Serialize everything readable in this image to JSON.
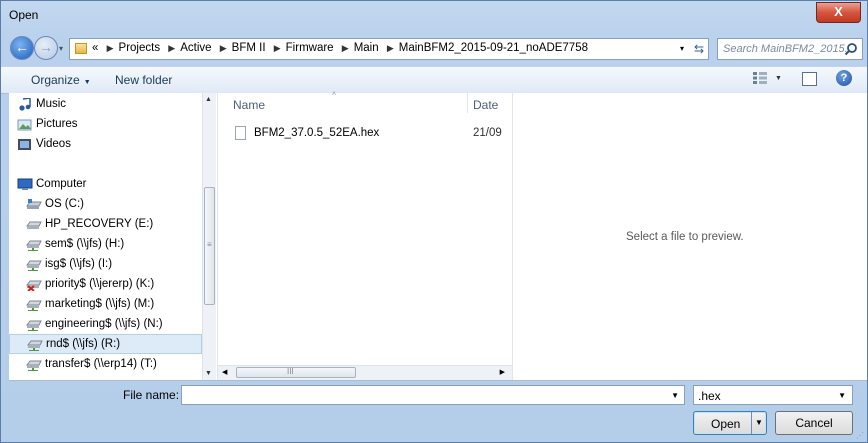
{
  "window": {
    "title": "Open",
    "close_glyph": "X"
  },
  "nav": {
    "back_glyph": "←",
    "forward_glyph": "→",
    "recent_glyph": "▾",
    "crumb_prefix": "«",
    "breadcrumbs": [
      "Projects",
      "Active",
      "BFM II",
      "Firmware",
      "Main",
      "MainBFM2_2015-09-21_noADE7758"
    ],
    "crumb_sep": "▶",
    "address_dropdown_glyph": "▾",
    "refresh_glyph": "⇆",
    "search_placeholder": "Search MainBFM2_2015..."
  },
  "toolbar": {
    "organize_label": "Organize",
    "organize_dd": "▼",
    "new_folder_label": "New folder",
    "views_dd": "▼",
    "help_glyph": "?"
  },
  "navpane": {
    "items": [
      {
        "label": "Music",
        "icon": "music-icon"
      },
      {
        "label": "Pictures",
        "icon": "pictures-icon"
      },
      {
        "label": "Videos",
        "icon": "videos-icon"
      },
      {
        "label": "Computer",
        "icon": "computer-icon"
      },
      {
        "label": "OS (C:)",
        "icon": "drive-icon"
      },
      {
        "label": "HP_RECOVERY (E:)",
        "icon": "drive-icon"
      },
      {
        "label": "sem$ (\\\\jfs) (H:)",
        "icon": "network-drive-icon"
      },
      {
        "label": "isg$ (\\\\jfs) (I:)",
        "icon": "network-drive-icon"
      },
      {
        "label": "priority$ (\\\\jererp) (K:)",
        "icon": "disconnected-drive-icon"
      },
      {
        "label": "marketing$ (\\\\jfs) (M:)",
        "icon": "network-drive-icon"
      },
      {
        "label": "engineering$ (\\\\jfs) (N:)",
        "icon": "network-drive-icon"
      },
      {
        "label": "rnd$ (\\\\jfs) (R:)",
        "icon": "network-drive-icon"
      },
      {
        "label": "transfer$ (\\\\erp14) (T:)",
        "icon": "network-drive-icon"
      }
    ],
    "scroll_up": "▲",
    "scroll_down": "▼",
    "grip": "≡"
  },
  "filelist": {
    "col_name": "Name",
    "col_date": "Date",
    "sort_glyph": "˄",
    "files": [
      {
        "name": "BFM2_37.0.5_52EA.hex",
        "date": "21/09"
      }
    ],
    "hscroll_left": "◀",
    "hscroll_right": "▶",
    "hgrip": "III"
  },
  "preview": {
    "text": "Select a file to preview."
  },
  "footer": {
    "filename_label": "File name:",
    "filename_value": "",
    "filename_dd": "▼",
    "filter_value": ".hex",
    "filter_dd": "▼",
    "open_label": "Open",
    "open_dd": "▼",
    "cancel_label": "Cancel",
    "corner_grip": "⋰"
  },
  "colors": {
    "accent": "#1b5ebd",
    "frame": "#b9d1ec",
    "close": "#c03a22"
  }
}
